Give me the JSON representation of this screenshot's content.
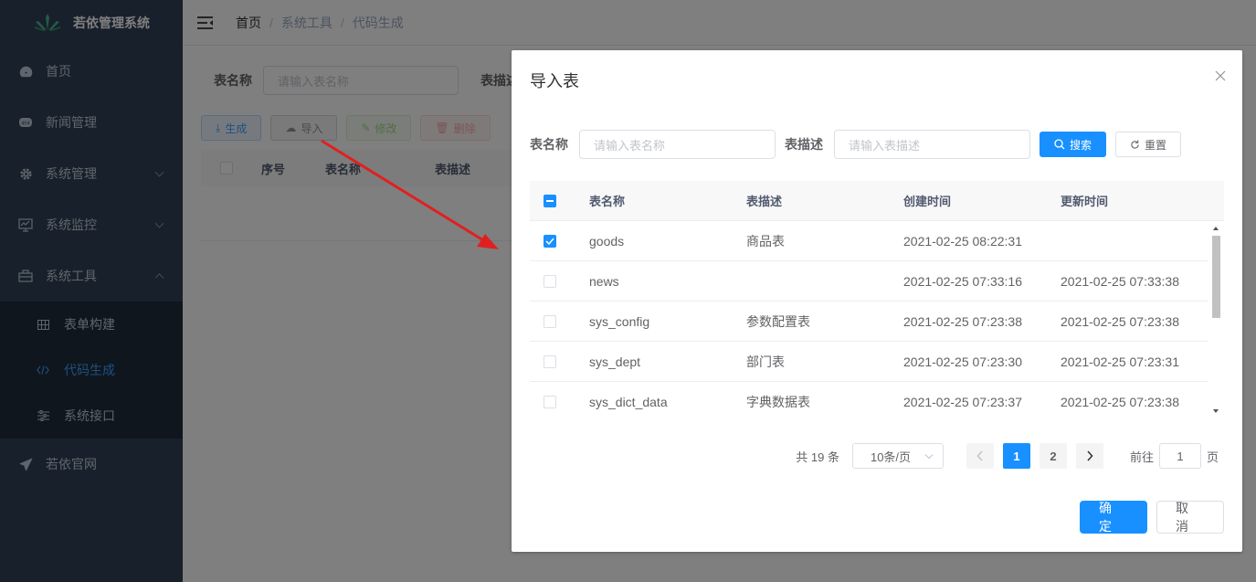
{
  "app": {
    "title": "若依管理系统"
  },
  "sidebar": {
    "items": [
      {
        "label": "首页",
        "icon": "dashboard-icon"
      },
      {
        "label": "新闻管理",
        "icon": "news-icon"
      },
      {
        "label": "系统管理",
        "icon": "gear-icon"
      },
      {
        "label": "系统监控",
        "icon": "monitor-icon"
      },
      {
        "label": "系统工具",
        "icon": "toolbox-icon"
      }
    ],
    "subitems": [
      {
        "label": "表单构建",
        "icon": "grid-icon"
      },
      {
        "label": "代码生成",
        "icon": "code-icon"
      },
      {
        "label": "系统接口",
        "icon": "sliders-icon"
      }
    ],
    "external": {
      "label": "若依官网",
      "icon": "send-icon"
    }
  },
  "breadcrumb": {
    "home": "首页",
    "level2": "系统工具",
    "level3": "代码生成"
  },
  "page": {
    "search": {
      "table_name_label": "表名称",
      "table_name_placeholder": "请输入表名称",
      "table_desc_label": "表描述"
    },
    "toolbar": {
      "generate": "生成",
      "import": "导入",
      "edit": "修改",
      "delete": "删除"
    },
    "table_headers": {
      "index": "序号",
      "table_name": "表名称",
      "table_desc": "表描述"
    }
  },
  "dialog": {
    "title": "导入表",
    "search": {
      "table_name_label": "表名称",
      "table_name_placeholder": "请输入表名称",
      "table_desc_label": "表描述",
      "table_desc_placeholder": "请输入表描述",
      "search_button": "搜索",
      "reset_button": "重置"
    },
    "table": {
      "headers": [
        "表名称",
        "表描述",
        "创建时间",
        "更新时间"
      ],
      "rows": [
        {
          "checked": true,
          "name": "goods",
          "desc": "商品表",
          "created": "2021-02-25 08:22:31",
          "updated": ""
        },
        {
          "checked": false,
          "name": "news",
          "desc": "",
          "created": "2021-02-25 07:33:16",
          "updated": "2021-02-25 07:33:38"
        },
        {
          "checked": false,
          "name": "sys_config",
          "desc": "参数配置表",
          "created": "2021-02-25 07:23:38",
          "updated": "2021-02-25 07:23:38"
        },
        {
          "checked": false,
          "name": "sys_dept",
          "desc": "部门表",
          "created": "2021-02-25 07:23:30",
          "updated": "2021-02-25 07:23:31"
        },
        {
          "checked": false,
          "name": "sys_dict_data",
          "desc": "字典数据表",
          "created": "2021-02-25 07:23:37",
          "updated": "2021-02-25 07:23:38"
        }
      ]
    },
    "pagination": {
      "total": "共 19 条",
      "page_size": "10条/页",
      "pages": [
        "1",
        "2"
      ],
      "current": "1",
      "goto_prefix": "前往",
      "goto_value": "1",
      "goto_suffix": "页"
    },
    "footer": {
      "confirm": "确 定",
      "cancel": "取 消"
    }
  },
  "colors": {
    "primary": "#1890ff",
    "sidebar_bg": "#304156",
    "sidebar_active": "#409eff"
  }
}
